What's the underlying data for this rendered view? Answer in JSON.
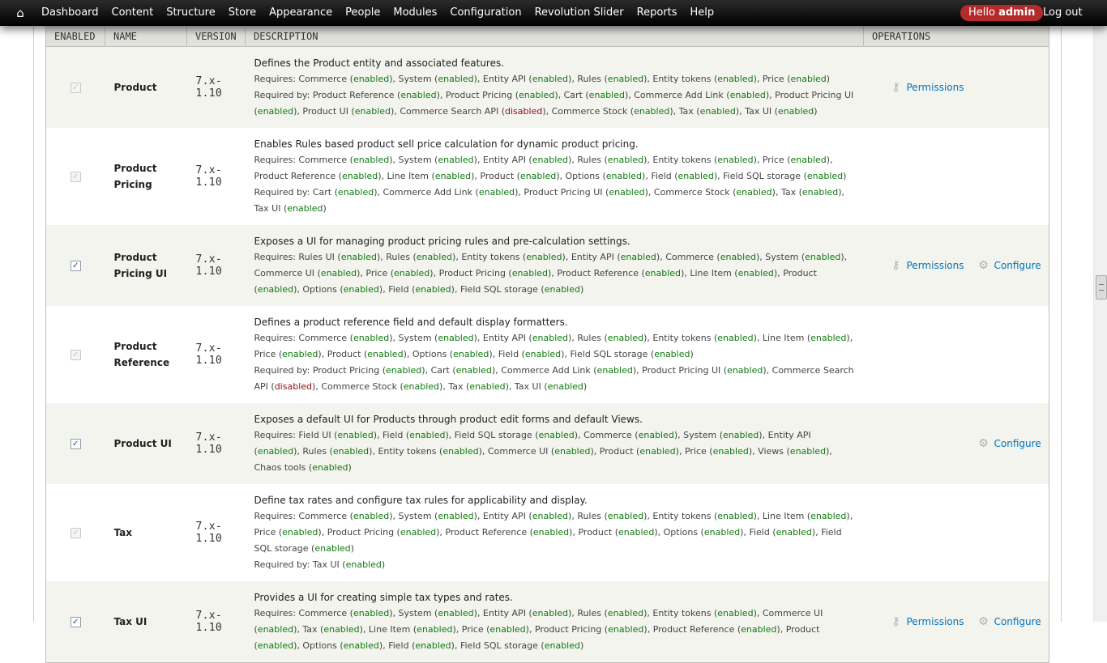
{
  "toolbar": {
    "home_icon": "home-icon",
    "menu": [
      "Dashboard",
      "Content",
      "Structure",
      "Store",
      "Appearance",
      "People",
      "Modules",
      "Configuration",
      "Revolution Slider",
      "Reports",
      "Help"
    ],
    "hello_prefix": "Hello ",
    "hello_user": "admin",
    "logout": "Log out"
  },
  "table": {
    "headers": [
      "ENABLED",
      "NAME",
      "VERSION",
      "DESCRIPTION",
      "OPERATIONS"
    ],
    "rows": [
      {
        "enabled": true,
        "locked": true,
        "name": "Product",
        "version": "7.x-1.10",
        "description": "Defines the Product entity and associated features.",
        "requires_label": "Requires:",
        "requires": [
          [
            "Commerce",
            "enabled"
          ],
          [
            "System",
            "enabled"
          ],
          [
            "Entity API",
            "enabled"
          ],
          [
            "Rules",
            "enabled"
          ],
          [
            "Entity tokens",
            "enabled"
          ],
          [
            "Price",
            "enabled"
          ]
        ],
        "required_by_label": "Required by:",
        "required_by": [
          [
            "Product Reference",
            "enabled"
          ],
          [
            "Product Pricing",
            "enabled"
          ],
          [
            "Cart",
            "enabled"
          ],
          [
            "Commerce Add Link",
            "enabled"
          ],
          [
            "Product Pricing UI",
            "enabled"
          ],
          [
            "Product UI",
            "enabled"
          ],
          [
            "Commerce Search API",
            "disabled"
          ],
          [
            "Commerce Stock",
            "enabled"
          ],
          [
            "Tax",
            "enabled"
          ],
          [
            "Tax UI",
            "enabled"
          ]
        ],
        "permissions": "Permissions",
        "configure": ""
      },
      {
        "enabled": true,
        "locked": true,
        "name": "Product Pricing",
        "version": "7.x-1.10",
        "description": "Enables Rules based product sell price calculation for dynamic product pricing.",
        "requires_label": "Requires:",
        "requires": [
          [
            "Commerce",
            "enabled"
          ],
          [
            "System",
            "enabled"
          ],
          [
            "Entity API",
            "enabled"
          ],
          [
            "Rules",
            "enabled"
          ],
          [
            "Entity tokens",
            "enabled"
          ],
          [
            "Price",
            "enabled"
          ],
          [
            "Product Reference",
            "enabled"
          ],
          [
            "Line Item",
            "enabled"
          ],
          [
            "Product",
            "enabled"
          ],
          [
            "Options",
            "enabled"
          ],
          [
            "Field",
            "enabled"
          ],
          [
            "Field SQL storage",
            "enabled"
          ]
        ],
        "required_by_label": "Required by:",
        "required_by": [
          [
            "Cart",
            "enabled"
          ],
          [
            "Commerce Add Link",
            "enabled"
          ],
          [
            "Product Pricing UI",
            "enabled"
          ],
          [
            "Commerce Stock",
            "enabled"
          ],
          [
            "Tax",
            "enabled"
          ],
          [
            "Tax UI",
            "enabled"
          ]
        ],
        "permissions": "",
        "configure": ""
      },
      {
        "enabled": true,
        "locked": false,
        "name": "Product Pricing UI",
        "version": "7.x-1.10",
        "description": "Exposes a UI for managing product pricing rules and pre-calculation settings.",
        "requires_label": "Requires:",
        "requires": [
          [
            "Rules UI",
            "enabled"
          ],
          [
            "Rules",
            "enabled"
          ],
          [
            "Entity tokens",
            "enabled"
          ],
          [
            "Entity API",
            "enabled"
          ],
          [
            "Commerce",
            "enabled"
          ],
          [
            "System",
            "enabled"
          ],
          [
            "Commerce UI",
            "enabled"
          ],
          [
            "Price",
            "enabled"
          ],
          [
            "Product Pricing",
            "enabled"
          ],
          [
            "Product Reference",
            "enabled"
          ],
          [
            "Line Item",
            "enabled"
          ],
          [
            "Product",
            "enabled"
          ],
          [
            "Options",
            "enabled"
          ],
          [
            "Field",
            "enabled"
          ],
          [
            "Field SQL storage",
            "enabled"
          ]
        ],
        "required_by_label": "",
        "required_by": [],
        "permissions": "Permissions",
        "configure": "Configure"
      },
      {
        "enabled": true,
        "locked": true,
        "name": "Product Reference",
        "version": "7.x-1.10",
        "description": "Defines a product reference field and default display formatters.",
        "requires_label": "Requires:",
        "requires": [
          [
            "Commerce",
            "enabled"
          ],
          [
            "System",
            "enabled"
          ],
          [
            "Entity API",
            "enabled"
          ],
          [
            "Rules",
            "enabled"
          ],
          [
            "Entity tokens",
            "enabled"
          ],
          [
            "Line Item",
            "enabled"
          ],
          [
            "Price",
            "enabled"
          ],
          [
            "Product",
            "enabled"
          ],
          [
            "Options",
            "enabled"
          ],
          [
            "Field",
            "enabled"
          ],
          [
            "Field SQL storage",
            "enabled"
          ]
        ],
        "required_by_label": "Required by:",
        "required_by": [
          [
            "Product Pricing",
            "enabled"
          ],
          [
            "Cart",
            "enabled"
          ],
          [
            "Commerce Add Link",
            "enabled"
          ],
          [
            "Product Pricing UI",
            "enabled"
          ],
          [
            "Commerce Search API",
            "disabled"
          ],
          [
            "Commerce Stock",
            "enabled"
          ],
          [
            "Tax",
            "enabled"
          ],
          [
            "Tax UI",
            "enabled"
          ]
        ],
        "permissions": "",
        "configure": ""
      },
      {
        "enabled": true,
        "locked": false,
        "name": "Product UI",
        "version": "7.x-1.10",
        "description": "Exposes a default UI for Products through product edit forms and default Views.",
        "requires_label": "Requires:",
        "requires": [
          [
            "Field UI",
            "enabled"
          ],
          [
            "Field",
            "enabled"
          ],
          [
            "Field SQL storage",
            "enabled"
          ],
          [
            "Commerce",
            "enabled"
          ],
          [
            "System",
            "enabled"
          ],
          [
            "Entity API",
            "enabled"
          ],
          [
            "Rules",
            "enabled"
          ],
          [
            "Entity tokens",
            "enabled"
          ],
          [
            "Commerce UI",
            "enabled"
          ],
          [
            "Product",
            "enabled"
          ],
          [
            "Price",
            "enabled"
          ],
          [
            "Views",
            "enabled"
          ],
          [
            "Chaos tools",
            "enabled"
          ]
        ],
        "required_by_label": "",
        "required_by": [],
        "permissions": "",
        "configure": "Configure"
      },
      {
        "enabled": true,
        "locked": true,
        "name": "Tax",
        "version": "7.x-1.10",
        "description": "Define tax rates and configure tax rules for applicability and display.",
        "requires_label": "Requires:",
        "requires": [
          [
            "Commerce",
            "enabled"
          ],
          [
            "System",
            "enabled"
          ],
          [
            "Entity API",
            "enabled"
          ],
          [
            "Rules",
            "enabled"
          ],
          [
            "Entity tokens",
            "enabled"
          ],
          [
            "Line Item",
            "enabled"
          ],
          [
            "Price",
            "enabled"
          ],
          [
            "Product Pricing",
            "enabled"
          ],
          [
            "Product Reference",
            "enabled"
          ],
          [
            "Product",
            "enabled"
          ],
          [
            "Options",
            "enabled"
          ],
          [
            "Field",
            "enabled"
          ],
          [
            "Field SQL storage",
            "enabled"
          ]
        ],
        "required_by_label": "Required by:",
        "required_by": [
          [
            "Tax UI",
            "enabled"
          ]
        ],
        "permissions": "",
        "configure": ""
      },
      {
        "enabled": true,
        "locked": false,
        "name": "Tax UI",
        "version": "7.x-1.10",
        "description": "Provides a UI for creating simple tax types and rates.",
        "requires_label": "Requires:",
        "requires": [
          [
            "Commerce",
            "enabled"
          ],
          [
            "System",
            "enabled"
          ],
          [
            "Entity API",
            "enabled"
          ],
          [
            "Rules",
            "enabled"
          ],
          [
            "Entity tokens",
            "enabled"
          ],
          [
            "Commerce UI",
            "enabled"
          ],
          [
            "Tax",
            "enabled"
          ],
          [
            "Line Item",
            "enabled"
          ],
          [
            "Price",
            "enabled"
          ],
          [
            "Product Pricing",
            "enabled"
          ],
          [
            "Product Reference",
            "enabled"
          ],
          [
            "Product",
            "enabled"
          ],
          [
            "Options",
            "enabled"
          ],
          [
            "Field",
            "enabled"
          ],
          [
            "Field SQL storage",
            "enabled"
          ]
        ],
        "required_by_label": "",
        "required_by": [],
        "permissions": "Permissions",
        "configure": "Configure"
      }
    ]
  },
  "colors": {
    "enabled_text": "#0f7a0f",
    "disabled_text": "#8a1010",
    "link": "#0074bd",
    "hello_badge": "#b52a2a"
  },
  "icons": {
    "permissions": "key-icon",
    "configure": "gear-icon"
  }
}
